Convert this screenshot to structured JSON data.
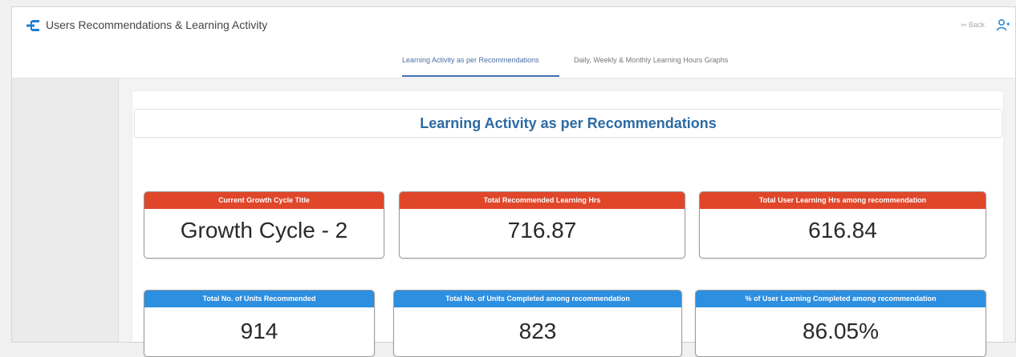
{
  "app": {
    "title": "Users Recommendations & Learning Activity",
    "topright_link": "⇦ Back"
  },
  "tabs": [
    {
      "label": "Learning Activity as per Recommendations",
      "active": true
    },
    {
      "label": "Daily, Weekly & Monthly Learning Hours Graphs",
      "active": false
    }
  ],
  "panel": {
    "title": "Learning Activity as per Recommendations"
  },
  "colors": {
    "accent": "#2d6aa3",
    "orange_header": "#e0462a",
    "blue_header": "#2d8fe0"
  },
  "cards": [
    {
      "label": "Current Growth Cycle Title",
      "value": "Growth Cycle - 2",
      "header_color": "orange"
    },
    {
      "label": "Total Recommended Learning Hrs",
      "value": "716.87",
      "header_color": "orange"
    },
    {
      "label": "Total User Learning Hrs among recommendation",
      "value": "616.84",
      "header_color": "orange"
    },
    {
      "label": "Total No. of Units Recommended",
      "value": "914",
      "header_color": "blue"
    },
    {
      "label": "Total No. of Units Completed among recommendation",
      "value": "823",
      "header_color": "blue"
    },
    {
      "label": "% of User Learning Completed among recommendation",
      "value": "86.05%",
      "header_color": "blue"
    }
  ],
  "icons": {
    "app": "hierarchy-icon",
    "user": "user-icon"
  }
}
